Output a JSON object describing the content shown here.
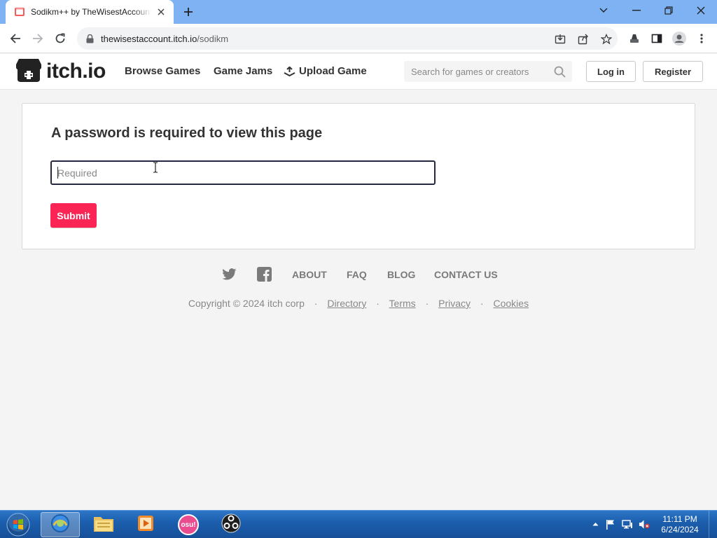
{
  "browser": {
    "tab_title": "Sodikm++ by TheWisestAccount",
    "url_host": "thewisestaccount.itch.io",
    "url_path": "/sodikm",
    "accent_color": "#7fb2f3"
  },
  "site": {
    "logo_text": "itch.io",
    "nav": {
      "browse_games": "Browse Games",
      "game_jams": "Game Jams",
      "upload_game": "Upload Game"
    },
    "search_placeholder": "Search for games or creators",
    "login_label": "Log in",
    "register_label": "Register",
    "brand_color": "#fa2555"
  },
  "main": {
    "title": "A password is required to view this page",
    "password_placeholder": "Required",
    "password_value": "",
    "submit_label": "Submit"
  },
  "footer": {
    "social_icons": [
      "twitter-icon",
      "facebook-icon"
    ],
    "links": {
      "about": "ABOUT",
      "faq": "FAQ",
      "blog": "BLOG",
      "contact": "CONTACT US"
    },
    "copyright": "Copyright © 2024 itch corp",
    "separator": "·",
    "legal": {
      "directory": "Directory",
      "terms": "Terms",
      "privacy": "Privacy",
      "cookies": "Cookies"
    }
  },
  "taskbar": {
    "apps": [
      "internet-explorer-icon",
      "file-explorer-icon",
      "media-player-icon",
      "osu-icon",
      "obs-icon"
    ],
    "osu_label": "osu!",
    "time": "11:11 PM",
    "date": "6/24/2024"
  }
}
